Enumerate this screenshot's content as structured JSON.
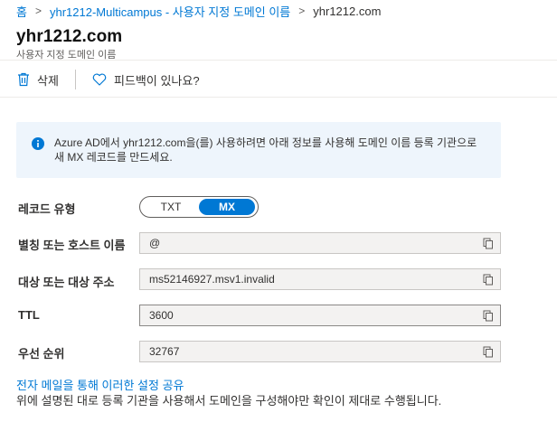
{
  "breadcrumb": {
    "home": "홈",
    "tenant": "yhr1212-Multicampus - 사용자 지정 도메인 이름",
    "current": "yhr1212.com"
  },
  "header": {
    "title": "yhr1212.com",
    "subtitle": "사용자 지정 도메인 이름"
  },
  "toolbar": {
    "delete_label": "삭제",
    "feedback_label": "피드백이 있나요?"
  },
  "info": {
    "text": "Azure AD에서 yhr1212.com을(를) 사용하려면 아래 정보를 사용해 도메인 이름 등록 기관으로 새 MX 레코드를 만드세요."
  },
  "form": {
    "record_type_label": "레코드 유형",
    "record_type_options": [
      "TXT",
      "MX"
    ],
    "record_type_selected": "MX",
    "alias_label": "별칭 또는 호스트 이름",
    "alias_value": "@",
    "target_label": "대상 또는 대상 주소",
    "target_value": "ms52146927.msv1.invalid",
    "ttl_label": "TTL",
    "ttl_value": "3600",
    "priority_label": "우선 순위",
    "priority_value": "32767"
  },
  "footer": {
    "share_link": "전자 메일을 통해 이러한 설정 공유",
    "note": "위에 설명된 대로 등록 기관을 사용해서 도메인을 구성해야만 확인이 제대로 수행됩니다."
  },
  "colors": {
    "accent": "#0078d4",
    "info_bg": "#eef5fc",
    "field_bg": "#f3f2f1"
  }
}
